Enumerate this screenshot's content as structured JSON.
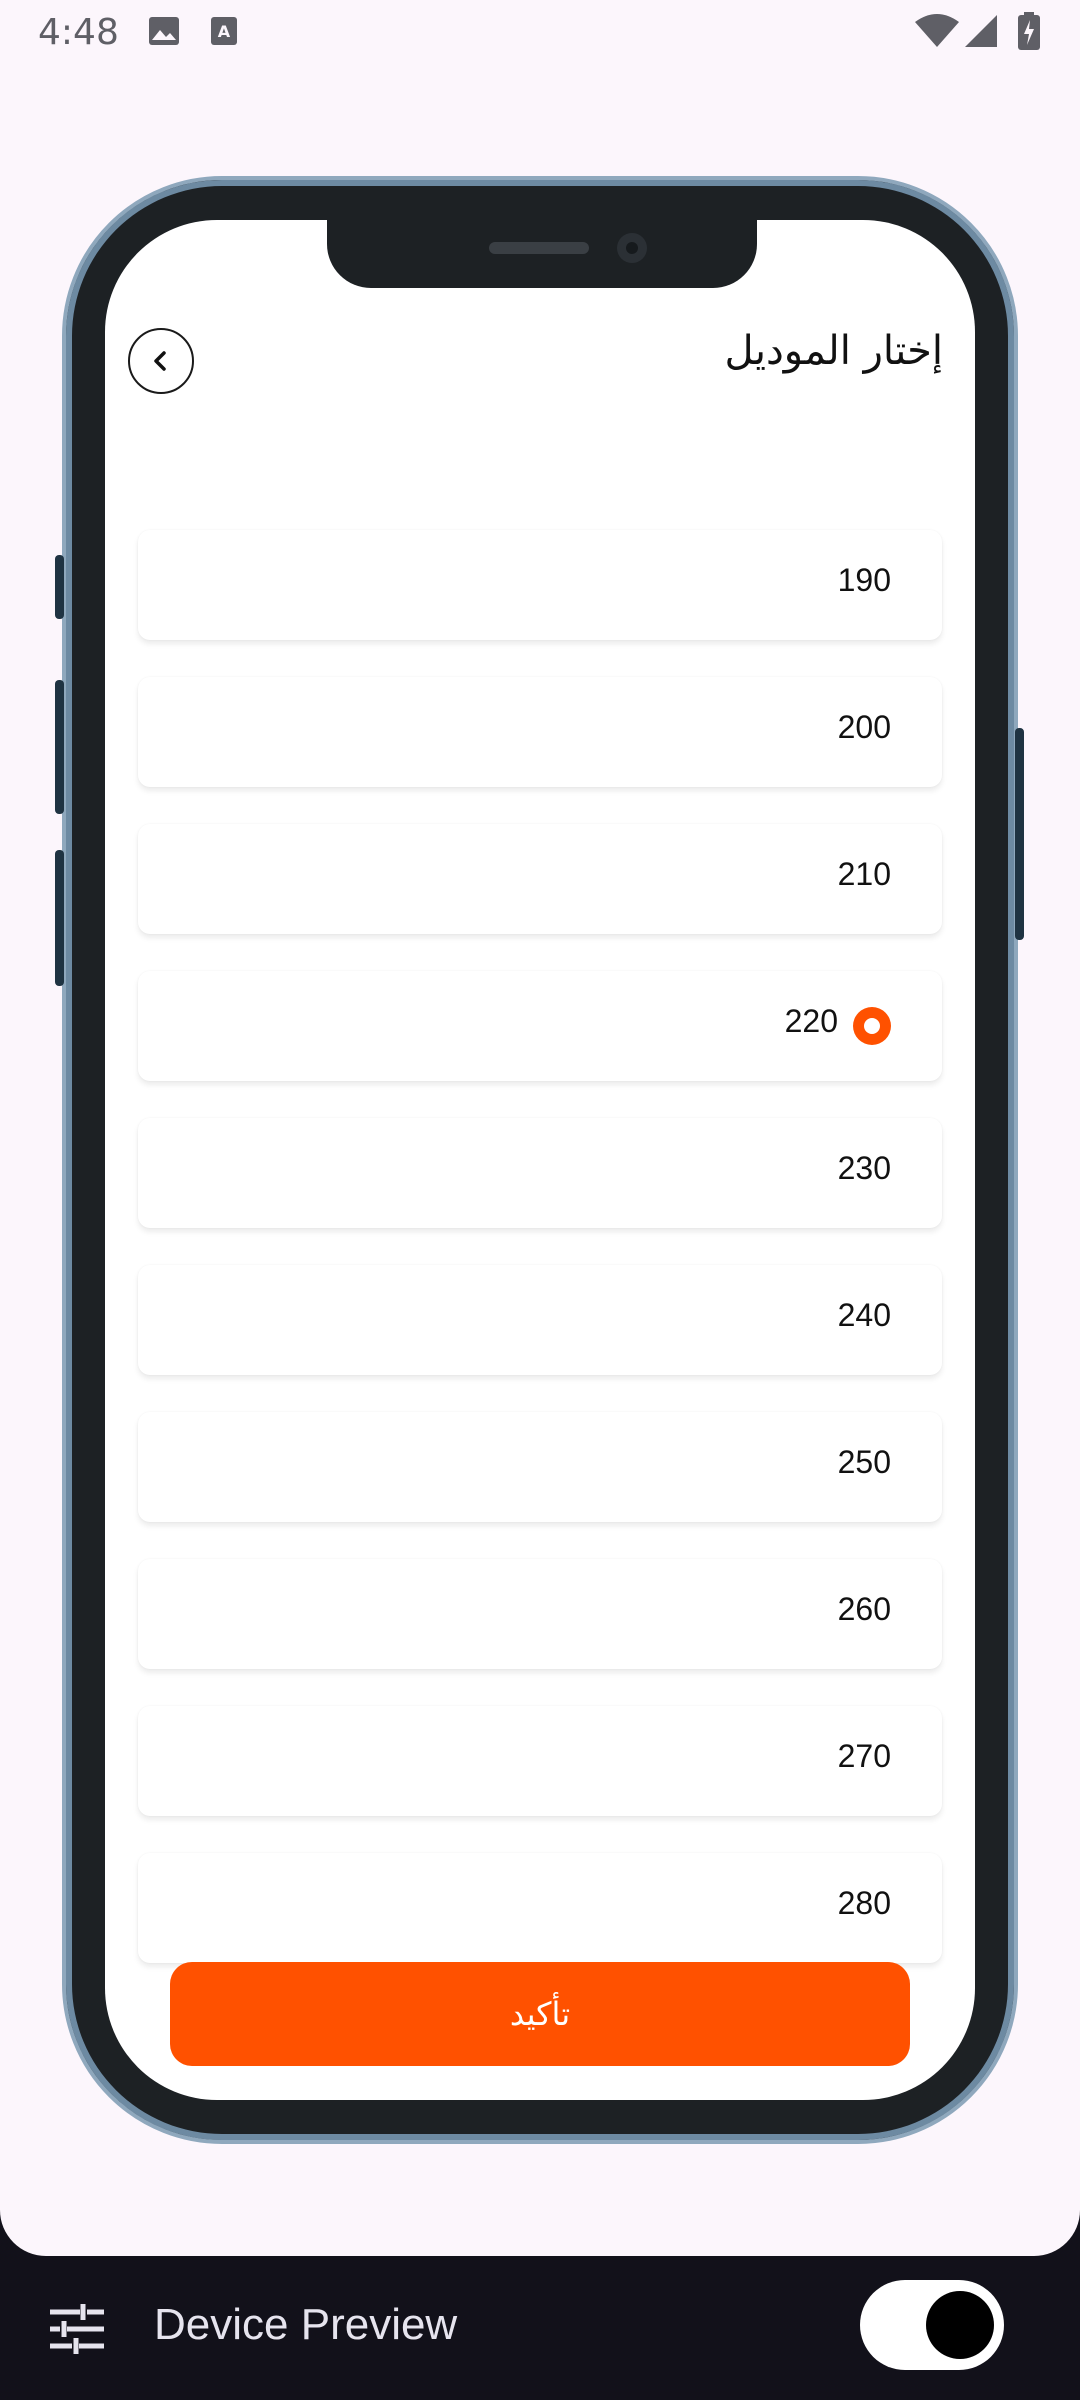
{
  "status_bar": {
    "time": "4:48",
    "icons": [
      "image-icon",
      "text-icon",
      "wifi-icon",
      "signal-icon",
      "battery-icon"
    ]
  },
  "screen": {
    "title": "إختار الموديل",
    "back_icon": "chevron-left-icon",
    "items": [
      {
        "label": "190",
        "selected": false
      },
      {
        "label": "200",
        "selected": false
      },
      {
        "label": "210",
        "selected": false
      },
      {
        "label": "220",
        "selected": true
      },
      {
        "label": "230",
        "selected": false
      },
      {
        "label": "240",
        "selected": false
      },
      {
        "label": "250",
        "selected": false
      },
      {
        "label": "260",
        "selected": false
      },
      {
        "label": "270",
        "selected": false
      },
      {
        "label": "280",
        "selected": false
      }
    ],
    "confirm_label": "تأكيد"
  },
  "device_preview": {
    "title": "Device Preview",
    "settings_icon": "sliders-icon",
    "toggle_on": true
  },
  "colors": {
    "accent": "#ff5100",
    "background": "#fcf6fc",
    "bottom_bar": "#12111a",
    "frame": "#1d2124"
  }
}
